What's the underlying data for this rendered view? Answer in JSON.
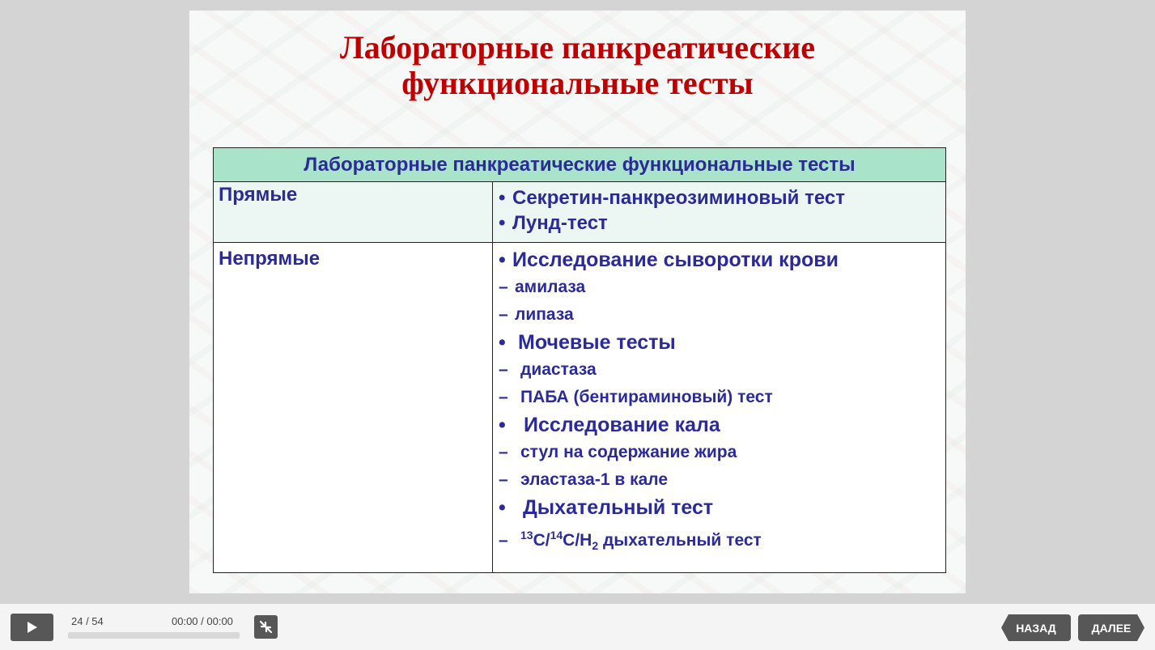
{
  "slide": {
    "title_line1": "Лабораторные панкреатические",
    "title_line2": "функциональные тесты",
    "table": {
      "header": "Лабораторные панкреатические функциональные тесты",
      "direct": {
        "label": "Прямые",
        "items": [
          {
            "marker": "•",
            "text": "Секретин-панкреозиминовый тест"
          },
          {
            "marker": "•",
            "text": "Лунд-тест"
          }
        ]
      },
      "indirect": {
        "label": "Непрямые",
        "items": [
          {
            "marker": "•",
            "text": "Исследование сыворотки крови"
          },
          {
            "marker": "–",
            "text": "амилаза"
          },
          {
            "marker": "–",
            "text": "липаза"
          },
          {
            "marker": "•",
            "text": "Мочевые тесты"
          },
          {
            "marker": "–",
            "text": "диастаза"
          },
          {
            "marker": "–",
            "text": "ПАБА (бентираминовый) тест"
          },
          {
            "marker": "•",
            "text": "Исследование кала"
          },
          {
            "marker": "–",
            "text": "стул на содержание жира"
          },
          {
            "marker": "–",
            "text": "эластаза-1 в кале"
          },
          {
            "marker": "•",
            "text": "Дыхательный тест"
          },
          {
            "marker": "–",
            "sup1": "13",
            "c1": "C/",
            "sup2": "14",
            "c2": "C/H",
            "sub": "2",
            "rest": " дыхательный тест"
          }
        ]
      }
    }
  },
  "player": {
    "slide_counter": "24 / 54",
    "time": "00:00 / 00:00",
    "progress": 0,
    "back_label": "НАЗАД",
    "next_label": "ДАЛЕЕ",
    "icons": {
      "play": "play-icon",
      "exit": "exit-fullscreen-icon"
    }
  }
}
